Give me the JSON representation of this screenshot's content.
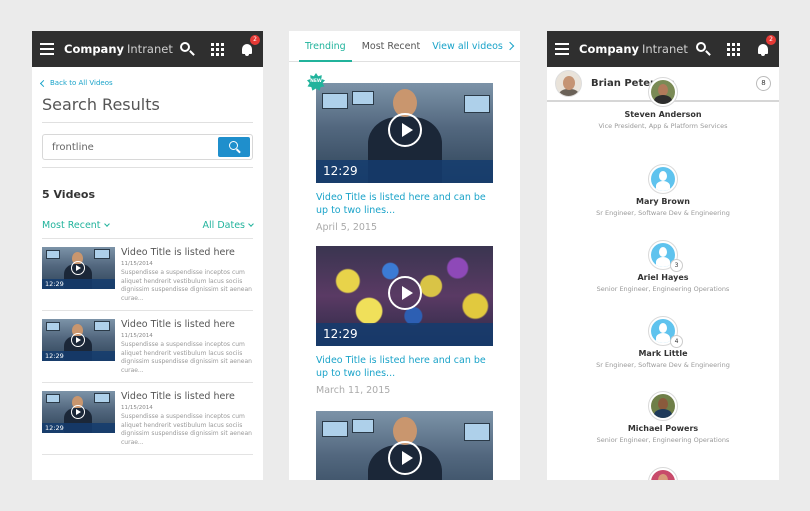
{
  "app": {
    "brand_bold": "Company",
    "brand_light": "Intranet",
    "notif_count": "2"
  },
  "search_screen": {
    "back_label": "Back to All Videos",
    "title": "Search Results",
    "query": "frontline",
    "count_label": "5 Videos",
    "filter_recent": "Most Recent",
    "filter_dates": "All Dates",
    "results": [
      {
        "title": "Video Title is listed here",
        "date": "11/15/2014",
        "excerpt": "Suspendisse a suspendisse inceptos cum aliquet hendrerit vestibulum lacus sociis dignissim suspendisse dignissim sit aenean curae...",
        "duration": "12:29"
      },
      {
        "title": "Video Title is listed here",
        "date": "11/15/2014",
        "excerpt": "Suspendisse a suspendisse inceptos cum aliquet hendrerit vestibulum lacus sociis dignissim suspendisse dignissim sit aenean curae...",
        "duration": "12:29"
      },
      {
        "title": "Video Title is listed here",
        "date": "11/15/2014",
        "excerpt": "Suspendisse a suspendisse inceptos cum aliquet hendrerit vestibulum lacus sociis dignissim suspendisse dignissim sit aenean curae...",
        "duration": "12:29"
      }
    ]
  },
  "feed_screen": {
    "tabs": [
      "Trending",
      "Most Recent",
      "View all videos"
    ],
    "new_tag": "NEW",
    "videos": [
      {
        "title": "Video Title is listed here and can be up to two lines...",
        "date": "April 5, 2015",
        "duration": "12:29"
      },
      {
        "title": "Video Title is listed here and can be up to two lines...",
        "date": "March 11, 2015",
        "duration": "12:29"
      }
    ]
  },
  "people_screen": {
    "user_name": "Brian Peterson",
    "user_count": "8",
    "people": [
      {
        "name": "Steven Anderson",
        "role": "Vice President, App & Platform Services"
      },
      {
        "name": "Mary Brown",
        "role": "Sr Engineer, Software Dev & Engineering"
      },
      {
        "name": "Ariel Hayes",
        "role": "Senior Engineer, Engineering Operations",
        "badge": "3"
      },
      {
        "name": "Mark Little",
        "role": "Sr Engineer, Software Dev & Engineering",
        "badge": "4"
      },
      {
        "name": "Michael Powers",
        "role": "Senior Engineer, Engineering Operations"
      }
    ]
  },
  "colors": {
    "accent_teal": "#21b39c",
    "link_blue": "#1aa3c9",
    "appbar": "#2f2f2f",
    "search_button": "#1f8fcc",
    "notif_red": "#e53935"
  },
  "icons": [
    "menu-icon",
    "search-icon",
    "apps-grid-icon",
    "bell-icon",
    "chevron-left-icon",
    "chevron-down-icon",
    "chevron-right-icon",
    "play-icon",
    "user-avatar-icon"
  ]
}
